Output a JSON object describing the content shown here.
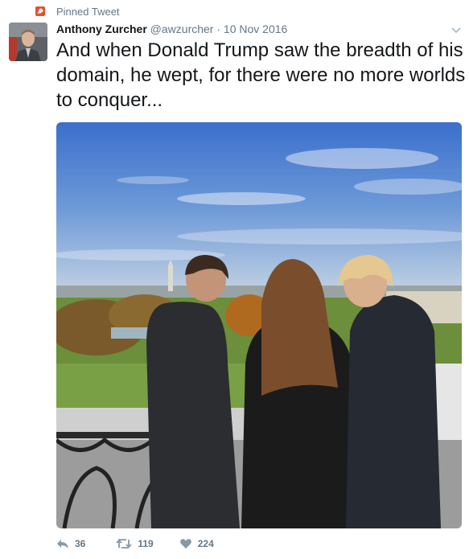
{
  "pinned": {
    "label": "Pinned Tweet",
    "icon": "pin-icon",
    "color": "#e0532e"
  },
  "author": {
    "name": "Anthony Zurcher",
    "handle": "@awzurcher",
    "separator": "·",
    "date": "10 Nov 2016"
  },
  "tweet": {
    "text": "And when Donald Trump saw the breadth of his domain, he wept, for there were no more worlds to conquer..."
  },
  "actions": {
    "reply": {
      "icon": "reply-icon",
      "count": "36"
    },
    "retweet": {
      "icon": "retweet-icon",
      "count": "119"
    },
    "like": {
      "icon": "heart-icon",
      "count": "224"
    }
  },
  "colors": {
    "text": "#14171a",
    "secondary": "#657786",
    "icon": "#8899a6"
  }
}
